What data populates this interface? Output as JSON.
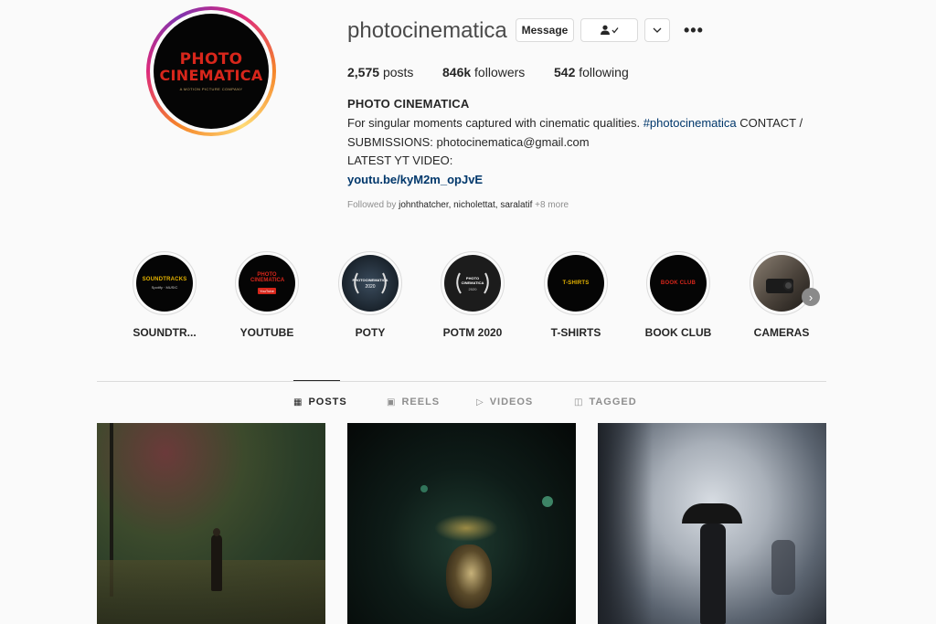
{
  "profile": {
    "username": "photocinematica",
    "avatar_line1": "PHOTO",
    "avatar_line2": "CINEMATICA",
    "avatar_tagline": "A MOTION PICTURE COMPANY",
    "message_label": "Message",
    "follow_icon": "person-check-icon",
    "dropdown_icon": "chevron-down-icon",
    "more_icon": "more-dots-icon",
    "more_glyph": "•••"
  },
  "stats": {
    "posts_count": "2,575",
    "posts_label": "posts",
    "followers_count": "846k",
    "followers_label": "followers",
    "following_count": "542",
    "following_label": "following"
  },
  "bio": {
    "name": "PHOTO CINEMATICA",
    "line1_text": "For singular moments captured with cinematic qualities. ",
    "line1_hashtag": "#photocinematica",
    "line1_tail": " CONTACT /",
    "line2": "SUBMISSIONS: photocinematica@gmail.com",
    "line3": "LATEST YT VIDEO:",
    "link": "youtu.be/kyM2m_opJvE",
    "followed_prefix": "Followed by",
    "followed_users": "johnthatcher, nicholettat, saralatif",
    "followed_more": "+8 more"
  },
  "highlights": [
    {
      "label": "SOUNDTR...",
      "cover_text": "SOUNDTRACKS",
      "cover_sub": "Spotify · MUSIC"
    },
    {
      "label": "YOUTUBE",
      "cover_text": "PHOTO CINEMATICA",
      "cover_sub": "YouTube"
    },
    {
      "label": "POTY",
      "cover_text": "PHOTOCINEMATICA",
      "cover_sub": "2020"
    },
    {
      "label": "POTM 2020",
      "cover_text": "PHOTO CINEMATICA",
      "cover_sub": "2020"
    },
    {
      "label": "T-SHIRTS",
      "cover_text": "T-SHIRTS",
      "cover_sub": ""
    },
    {
      "label": "BOOK CLUB",
      "cover_text": "BOOK CLUB",
      "cover_sub": ""
    },
    {
      "label": "CAMERAS",
      "cover_text": "",
      "cover_sub": ""
    }
  ],
  "tabs": [
    {
      "label": "POSTS",
      "icon": "grid-icon",
      "glyph": "▦",
      "active": true
    },
    {
      "label": "REELS",
      "icon": "reels-icon",
      "glyph": "▣",
      "active": false
    },
    {
      "label": "VIDEOS",
      "icon": "play-icon",
      "glyph": "▷",
      "active": false
    },
    {
      "label": "TAGGED",
      "icon": "tag-icon",
      "glyph": "◫",
      "active": false
    }
  ],
  "colors": {
    "link": "#00376b",
    "accent_red": "#d7261b",
    "gold": "#e6b400"
  },
  "posts": [
    {
      "description_icon": "photo-foggy-street-figure"
    },
    {
      "description_icon": "photo-dark-face-lights"
    },
    {
      "description_icon": "photo-umbrella-steam"
    }
  ]
}
